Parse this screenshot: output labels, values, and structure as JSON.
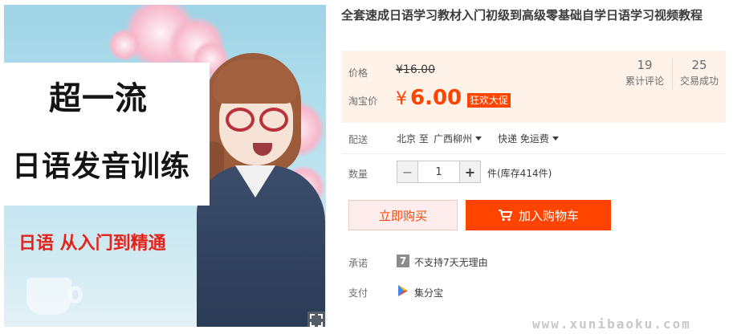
{
  "image": {
    "line1": "超一流",
    "line2": "日语发音训练",
    "line3": "日语 从入门到精通"
  },
  "product": {
    "title": "全套速成日语学习教材入门初级到高级零基础自学日语学习视频教程"
  },
  "price": {
    "label": "价格",
    "original": "¥16.00",
    "promo_label": "淘宝价",
    "currency": "¥",
    "value": "6.00",
    "badge": "狂欢大促"
  },
  "stats": [
    {
      "value": "19",
      "label": "累计评论"
    },
    {
      "value": "25",
      "label": "交易成功"
    }
  ],
  "shipping": {
    "label": "配送",
    "from": "北京 至",
    "to": "广西柳州",
    "method": "快递 免运费"
  },
  "quantity": {
    "label": "数量",
    "minus": "−",
    "value": "1",
    "plus": "+",
    "stock": "件(库存414件)"
  },
  "actions": {
    "buy_now": "立即购买",
    "add_to_cart": "加入购物车"
  },
  "promise": {
    "label": "承诺",
    "icon_text": "7",
    "text": "不支持7天无理由"
  },
  "payment": {
    "label": "支付",
    "text": "集分宝"
  },
  "watermark": "www.xunibaoku.com",
  "colors": {
    "accent": "#ff4400",
    "price_bg": "#fff2e8"
  }
}
